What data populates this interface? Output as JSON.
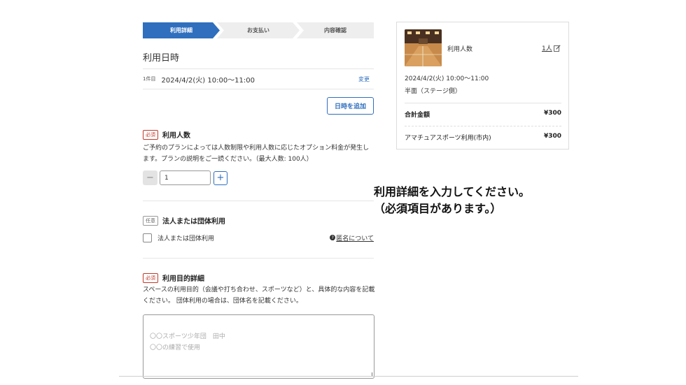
{
  "steps": [
    "利用詳細",
    "お支払い",
    "内容確認"
  ],
  "datetime_section": {
    "title": "利用日時",
    "entries": [
      {
        "index": "1件目",
        "datetime": "2024/4/2(火) 10:00～11:00",
        "change_label": "変更"
      }
    ],
    "add_button": "日時を追加"
  },
  "people_field": {
    "badge": "必須",
    "title": "利用人数",
    "description": "ご予約のプランによっては人数制限や利用人数に応じたオプション料金が発生します。プランの説明をご一読ください。（最大人数: 100人）",
    "value": "1",
    "minus": "−",
    "plus": "+"
  },
  "corporate_field": {
    "badge": "任意",
    "title": "法人または団体利用",
    "checkbox_label": "法人または団体利用",
    "anon_icon": "?",
    "anon_link": "匿名について"
  },
  "purpose_field": {
    "badge": "必須",
    "title": "利用目的詳細",
    "description": "スペースの利用目的（会議や打ち合わせ、スポーツなど）と、具体的な内容を記載ください。 団体利用の場合は、団体名を記載ください。",
    "placeholder": "〇〇スポーツ少年団　田中\n〇〇の練習で使用"
  },
  "summary": {
    "people_label": "利用人数",
    "people_value": "1人",
    "datetime": "2024/4/2(火) 10:00～11:00",
    "plan": "半面（ステージ側）",
    "total_label": "合計金額",
    "total_value": "¥300",
    "line_label": "アマチュアスポーツ利用(市内)",
    "line_value": "¥300"
  },
  "notice": "利用詳細を入力してください。\n（必須項目があります。）"
}
